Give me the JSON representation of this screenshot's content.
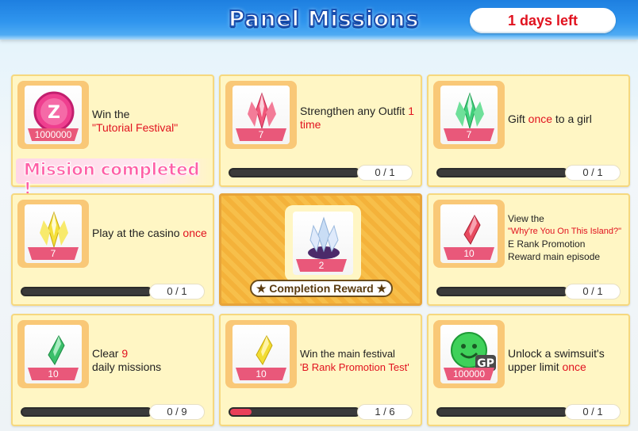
{
  "header": {
    "title": "Panel Missions",
    "days_left": "1 days left"
  },
  "missions": [
    {
      "desc_pre": "Win the",
      "desc_hl": "\"Tutorial Festival\"",
      "desc_post": "",
      "reward_qty": "1000000",
      "completed_label": "Mission completed !",
      "icon": "coin-icon"
    },
    {
      "desc_pre": "Strengthen any Outfit",
      "desc_hl": "1 time",
      "desc_post": "",
      "reward_qty": "7",
      "progress_text": "0 / 1",
      "progress": 0,
      "icon": "pink-crystal-icon"
    },
    {
      "desc_pre": "Gift",
      "desc_hl": "once",
      "desc_post": "to a girl",
      "reward_qty": "7",
      "progress_text": "0 / 1",
      "progress": 0,
      "icon": "green-crystal-icon"
    },
    {
      "desc_pre": "Play at the casino",
      "desc_hl": "once",
      "desc_post": "",
      "reward_qty": "7",
      "progress_text": "0 / 1",
      "progress": 0,
      "icon": "yellow-crystal-icon"
    },
    {
      "reward_qty": "2",
      "completion_label": "★ Completion Reward ★",
      "icon": "crystal-cluster-icon"
    },
    {
      "desc_l1": "View the",
      "desc_hl": "\"Why're You On This Island?\"",
      "desc_l3": "E Rank Promotion",
      "desc_l4": "Reward main episode",
      "reward_qty": "10",
      "progress_text": "0 / 1",
      "progress": 0,
      "icon": "red-gem-icon"
    },
    {
      "desc_pre": "Clear",
      "desc_hl": "9",
      "desc_post": "daily missions",
      "reward_qty": "10",
      "progress_text": "0 / 9",
      "progress": 0,
      "icon": "green-gem-icon"
    },
    {
      "desc_pre": "Win the main festival",
      "desc_hl": "'B Rank Promotion Test'",
      "desc_post": "",
      "reward_qty": "10",
      "progress_text": "1 / 6",
      "progress": 0.1667,
      "icon": "yellow-gem-icon"
    },
    {
      "desc_pre": "Unlock a swimsuit's upper limit",
      "desc_hl": "once",
      "desc_post": "",
      "reward_qty": "100000",
      "progress_text": "0 / 1",
      "progress": 0,
      "icon": "gp-smiley-icon",
      "gp_label": "GP"
    }
  ]
}
